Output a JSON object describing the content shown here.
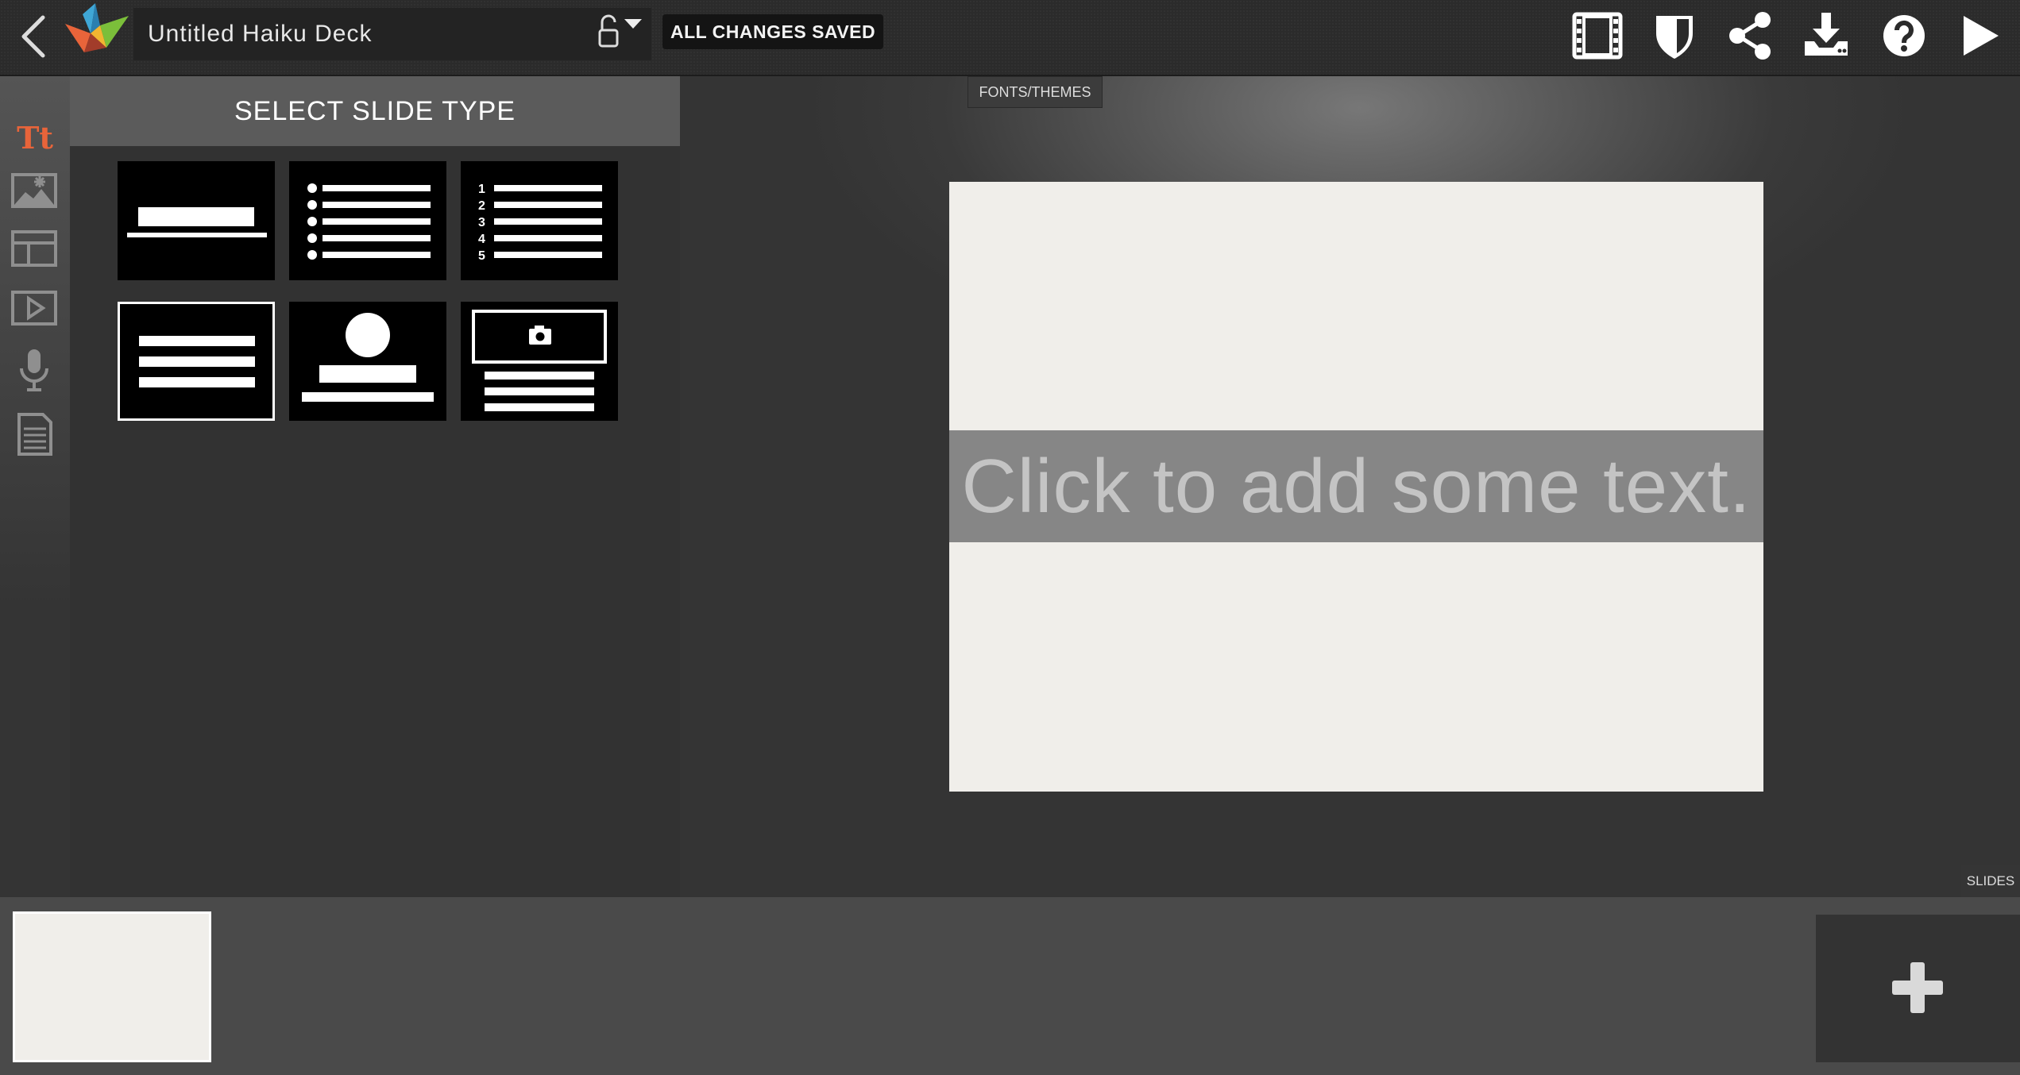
{
  "header": {
    "deck_title": "Untitled Haiku Deck",
    "save_status": "ALL CHANGES SAVED",
    "toolbar_icons": [
      "film-icon",
      "shield-icon",
      "share-icon",
      "download-icon",
      "help-icon",
      "play-icon"
    ]
  },
  "sidebar": {
    "items": [
      "text-icon",
      "image-icon",
      "layout-icon",
      "video-icon",
      "microphone-icon",
      "notes-icon"
    ],
    "text_tool_label": "Tt",
    "active_color": "#e8643a"
  },
  "slide_type_panel": {
    "title": "SELECT SLIDE TYPE",
    "types": [
      "title",
      "bullet-list",
      "numbered-list",
      "text-block",
      "profile",
      "photo-caption"
    ],
    "selected": "text-block",
    "numbered_labels": [
      "1",
      "2",
      "3",
      "4",
      "5"
    ]
  },
  "canvas": {
    "fonts_themes_tab": "FONTS/THEMES",
    "placeholder_text": "Click to add some text.",
    "slides_tab": "SLIDES"
  },
  "colors": {
    "background": "#343434",
    "slide_background": "#f0eeea",
    "text_band": "#868686"
  }
}
